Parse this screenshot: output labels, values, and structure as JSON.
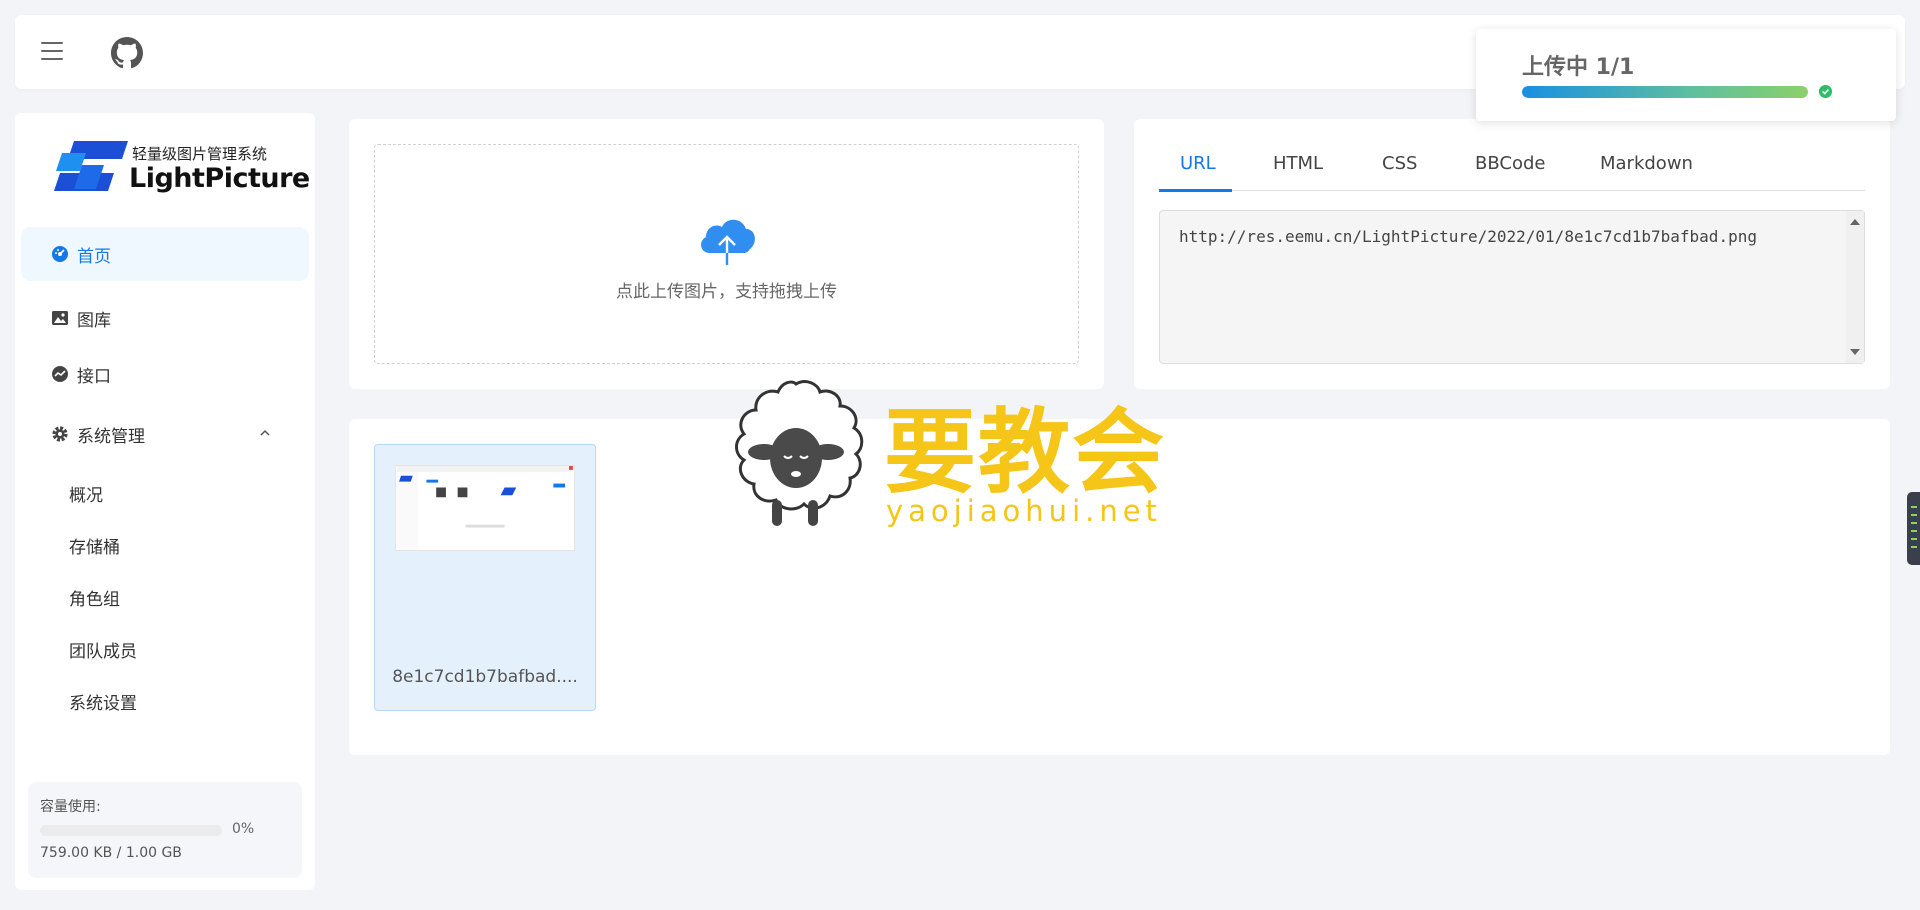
{
  "toast": {
    "title": "上传中 1/1",
    "progress": 1.0
  },
  "logo": {
    "subtitle": "轻量级图片管理系统",
    "name": "LightPicture"
  },
  "sidebar": {
    "items": [
      {
        "label": "首页",
        "icon": "dashboard-icon",
        "active": true
      },
      {
        "label": "图库",
        "icon": "image-icon"
      },
      {
        "label": "接口",
        "icon": "api-icon"
      },
      {
        "label": "系统管理",
        "icon": "gear-icon",
        "expanded": true
      }
    ],
    "sub_items": [
      "概况",
      "存储桶",
      "角色组",
      "团队成员",
      "系统设置"
    ],
    "storage": {
      "label": "容量使用:",
      "percent": "0%",
      "percent_value": 0,
      "size": "759.00 KB / 1.00 GB"
    }
  },
  "upload": {
    "hint": "点此上传图片，支持拖拽上传"
  },
  "code": {
    "tabs": [
      "URL",
      "HTML",
      "CSS",
      "BBCode",
      "Markdown"
    ],
    "active_tab": "URL",
    "value": "http://res.eemu.cn/LightPicture/2022/01/8e1c7cd1b7bafbad.png"
  },
  "gallery": {
    "items": [
      {
        "name": "8e1c7cd1b7bafbad...."
      }
    ]
  },
  "watermark": {
    "text": "要教会",
    "url": "yaojiaohui.net"
  },
  "colors": {
    "primary": "#1677e6",
    "active_bg": "#eff7ff",
    "watermark": "#f5c518",
    "success": "#2bbf6a"
  }
}
